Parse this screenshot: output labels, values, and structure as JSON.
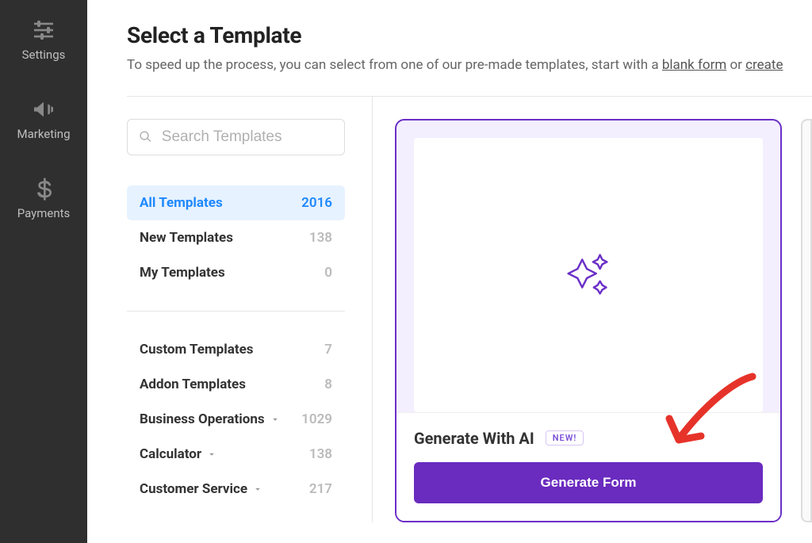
{
  "nav": {
    "settings": "Settings",
    "marketing": "Marketing",
    "payments": "Payments"
  },
  "header": {
    "title": "Select a Template",
    "sub_prefix": "To speed up the process, you can select from one of our pre-made templates, start with a ",
    "link_blank": "blank form",
    "sub_mid": " or ",
    "link_create": "create"
  },
  "search": {
    "placeholder": "Search Templates"
  },
  "categories_top": [
    {
      "label": "All Templates",
      "count": "2016",
      "active": true
    },
    {
      "label": "New Templates",
      "count": "138",
      "active": false
    },
    {
      "label": "My Templates",
      "count": "0",
      "active": false
    }
  ],
  "categories_bottom": [
    {
      "label": "Custom Templates",
      "count": "7",
      "expandable": false
    },
    {
      "label": "Addon Templates",
      "count": "8",
      "expandable": false
    },
    {
      "label": "Business Operations",
      "count": "1029",
      "expandable": true
    },
    {
      "label": "Calculator",
      "count": "138",
      "expandable": true
    },
    {
      "label": "Customer Service",
      "count": "217",
      "expandable": true
    }
  ],
  "card": {
    "title": "Generate With AI",
    "badge": "NEW!",
    "button": "Generate Form"
  },
  "colors": {
    "accent_purple": "#6b2fc7",
    "accent_blue": "#1e88ff",
    "nav_bg": "#2f2f2f"
  }
}
